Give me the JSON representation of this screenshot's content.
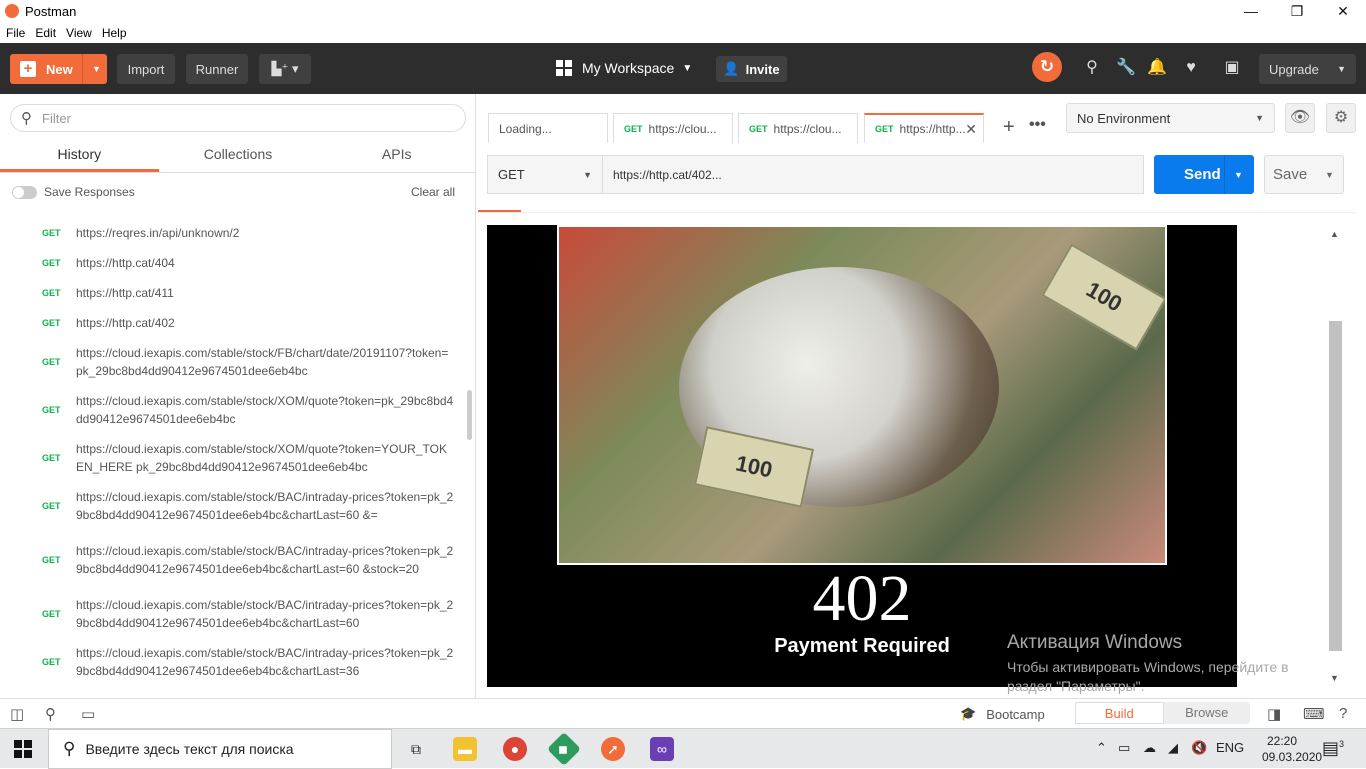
{
  "window": {
    "title": "Postman",
    "minimize": "—",
    "maximize": "❐",
    "close": "✕"
  },
  "menu": [
    "File",
    "Edit",
    "View",
    "Help"
  ],
  "header": {
    "new_label": "New",
    "import_label": "Import",
    "runner_label": "Runner",
    "workspace_label": "My Workspace",
    "invite_label": "Invite",
    "upgrade_label": "Upgrade"
  },
  "sidebar": {
    "filter_placeholder": "Filter",
    "tabs": [
      "History",
      "Collections",
      "APIs"
    ],
    "save_responses_label": "Save Responses",
    "clear_all_label": "Clear all",
    "history": [
      {
        "method": "GET",
        "url": "https://reqres.in/api/unknown/2"
      },
      {
        "method": "GET",
        "url": "https://http.cat/404"
      },
      {
        "method": "GET",
        "url": "https://http.cat/411"
      },
      {
        "method": "GET",
        "url": "https://http.cat/402"
      },
      {
        "method": "GET",
        "url": "https://cloud.iexapis.com/stable/stock/FB/chart/date/20191107?token=pk_29bc8bd4dd90412e9674501dee6eb4bc"
      },
      {
        "method": "GET",
        "url": "https://cloud.iexapis.com/stable/stock/XOM/quote?token=pk_29bc8bd4dd90412e9674501dee6eb4bc"
      },
      {
        "method": "GET",
        "url": "https://cloud.iexapis.com/stable/stock/XOM/quote?token=YOUR_TOKEN_HERE pk_29bc8bd4dd90412e9674501dee6eb4bc"
      },
      {
        "method": "GET",
        "url": "https://cloud.iexapis.com/stable/stock/BAC/intraday-prices?token=pk_29bc8bd4dd90412e9674501dee6eb4bc&chartLast=60 &="
      },
      {
        "method": "GET",
        "url": "https://cloud.iexapis.com/stable/stock/BAC/intraday-prices?token=pk_29bc8bd4dd90412e9674501dee6eb4bc&chartLast=60 &stock=20"
      },
      {
        "method": "GET",
        "url": "https://cloud.iexapis.com/stable/stock/BAC/intraday-prices?token=pk_29bc8bd4dd90412e9674501dee6eb4bc&chartLast=60"
      },
      {
        "method": "GET",
        "url": "https://cloud.iexapis.com/stable/stock/BAC/intraday-prices?token=pk_29bc8bd4dd90412e9674501dee6eb4bc&chartLast=36"
      }
    ]
  },
  "request_tabs": [
    {
      "method": "",
      "label": "Loading..."
    },
    {
      "method": "GET",
      "label": "https://clou..."
    },
    {
      "method": "GET",
      "label": "https://clou..."
    },
    {
      "method": "GET",
      "label": "https://http..."
    }
  ],
  "environment": {
    "selected": "No Environment"
  },
  "request": {
    "method": "GET",
    "url": "https://http.cat/402...",
    "send_label": "Send",
    "save_label": "Save"
  },
  "response": {
    "code": "402",
    "text": "Payment Required",
    "bill_1": "100",
    "bill_2": "100"
  },
  "watermark": {
    "line1": "Активация Windows",
    "line2": "Чтобы активировать Windows, перейдите в",
    "line3": "раздел \"Параметры\"."
  },
  "footer": {
    "bootcamp_label": "Bootcamp",
    "build_label": "Build",
    "browse_label": "Browse"
  },
  "taskbar": {
    "search_placeholder": "Введите здесь текст для поиска",
    "lang": "ENG",
    "time": "22:20",
    "date": "09.03.2020",
    "notification_count": "3"
  },
  "colors": {
    "accent": "#f26b3a",
    "send": "#097bed",
    "get": "#0cb44b",
    "header": "#2d2d2d"
  }
}
